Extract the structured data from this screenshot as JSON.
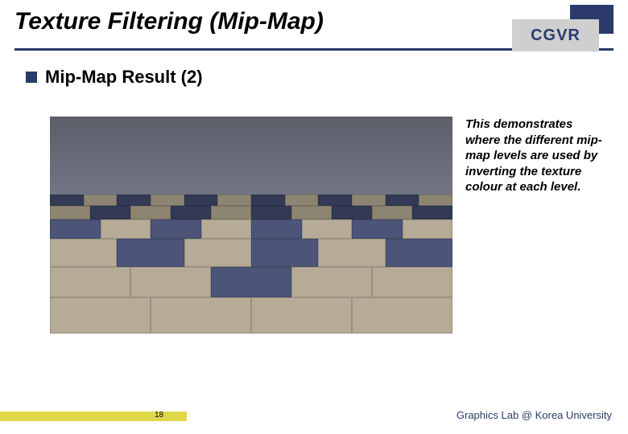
{
  "header": {
    "title": "Texture Filtering (Mip-Map)",
    "logo": "CGVR"
  },
  "subtitle": "Mip-Map Result (2)",
  "caption": "This demonstrates where the different mip-map levels are used by inverting the texture colour at each level.",
  "footer": {
    "page": "18",
    "credit": "Graphics Lab @ Korea University"
  }
}
